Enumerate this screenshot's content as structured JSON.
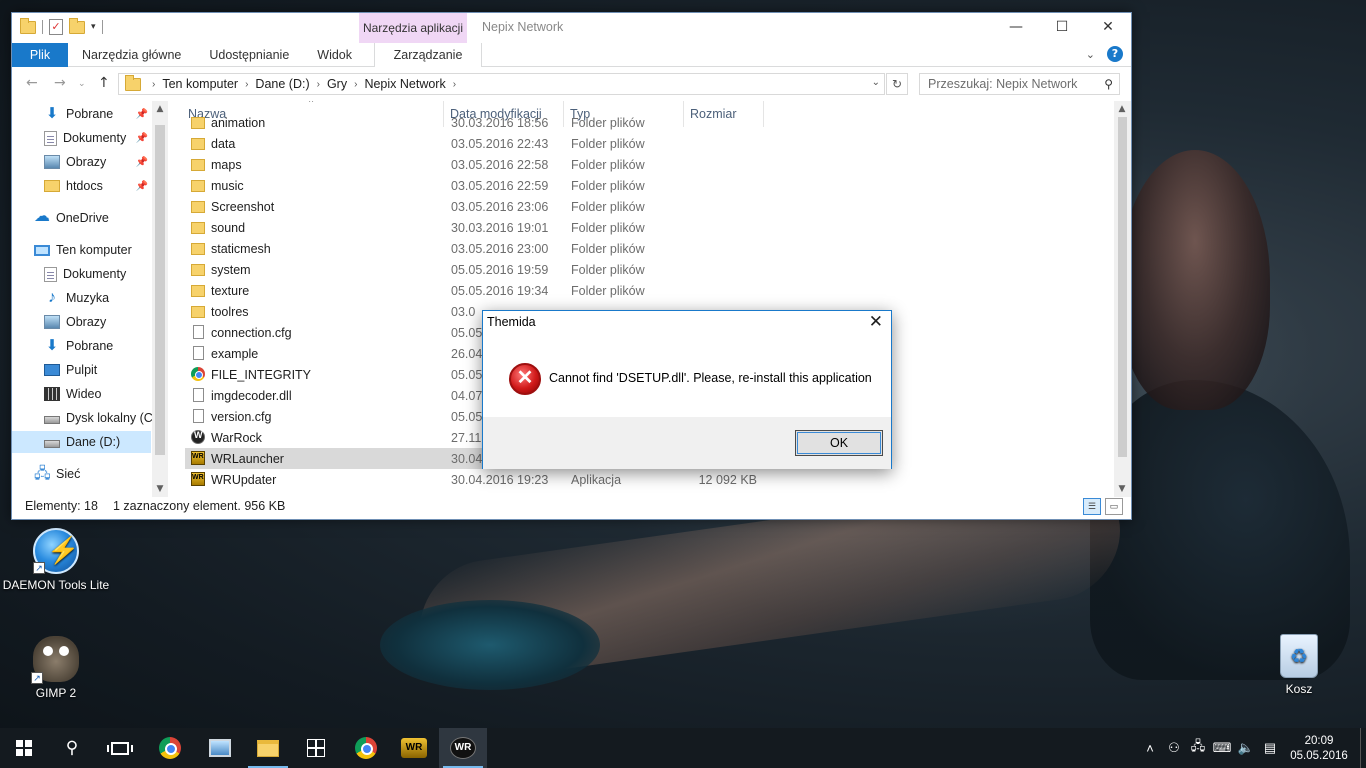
{
  "explorer": {
    "window_title": "Nepix Network",
    "contextual_tab_header": "Narzędzia aplikacji",
    "ribbon_tabs": [
      "Plik",
      "Narzędzia główne",
      "Udostępnianie",
      "Widok",
      "Zarządzanie"
    ],
    "breadcrumb": [
      "Ten komputer",
      "Dane (D:)",
      "Gry",
      "Nepix Network"
    ],
    "search_placeholder": "Przeszukaj: Nepix Network",
    "nav_items": [
      {
        "label": "Pobrane",
        "icon": "download-icon",
        "pinned": true
      },
      {
        "label": "Dokumenty",
        "icon": "documents-icon",
        "pinned": true
      },
      {
        "label": "Obrazy",
        "icon": "pictures-icon",
        "pinned": true
      },
      {
        "label": "htdocs",
        "icon": "folder-icon",
        "pinned": true
      },
      {
        "label": "OneDrive",
        "icon": "onedrive-icon"
      },
      {
        "label": "Ten komputer",
        "icon": "computer-icon"
      },
      {
        "label": "Dokumenty",
        "icon": "documents-icon"
      },
      {
        "label": "Muzyka",
        "icon": "music-icon"
      },
      {
        "label": "Obrazy",
        "icon": "pictures-icon"
      },
      {
        "label": "Pobrane",
        "icon": "download-icon"
      },
      {
        "label": "Pulpit",
        "icon": "desktop-icon"
      },
      {
        "label": "Wideo",
        "icon": "video-icon"
      },
      {
        "label": "Dysk lokalny (C:)",
        "icon": "drive-icon"
      },
      {
        "label": "Dane (D:)",
        "icon": "drive-icon",
        "selected": true
      },
      {
        "label": "Sieć",
        "icon": "network-icon"
      }
    ],
    "columns": {
      "name": "Nazwa",
      "date": "Data modyfikacji",
      "type": "Typ",
      "size": "Rozmiar"
    },
    "files": [
      {
        "name": "animation",
        "date": "30.03.2016 18:56",
        "type": "Folder plików",
        "size": "",
        "icon": "folder"
      },
      {
        "name": "data",
        "date": "03.05.2016 22:43",
        "type": "Folder plików",
        "size": "",
        "icon": "folder"
      },
      {
        "name": "maps",
        "date": "03.05.2016 22:58",
        "type": "Folder plików",
        "size": "",
        "icon": "folder"
      },
      {
        "name": "music",
        "date": "03.05.2016 22:59",
        "type": "Folder plików",
        "size": "",
        "icon": "folder"
      },
      {
        "name": "Screenshot",
        "date": "03.05.2016 23:06",
        "type": "Folder plików",
        "size": "",
        "icon": "folder"
      },
      {
        "name": "sound",
        "date": "30.03.2016 19:01",
        "type": "Folder plików",
        "size": "",
        "icon": "folder"
      },
      {
        "name": "staticmesh",
        "date": "03.05.2016 23:00",
        "type": "Folder plików",
        "size": "",
        "icon": "folder"
      },
      {
        "name": "system",
        "date": "05.05.2016 19:59",
        "type": "Folder plików",
        "size": "",
        "icon": "folder"
      },
      {
        "name": "texture",
        "date": "05.05.2016 19:34",
        "type": "Folder plików",
        "size": "",
        "icon": "folder"
      },
      {
        "name": "toolres",
        "date": "03.0",
        "type": "",
        "size": "",
        "icon": "folder"
      },
      {
        "name": "connection.cfg",
        "date": "05.05.",
        "type": "",
        "size": "",
        "icon": "file"
      },
      {
        "name": "example",
        "date": "26.04.",
        "type": "",
        "size": "",
        "icon": "file"
      },
      {
        "name": "FILE_INTEGRITY",
        "date": "05.05.",
        "type": "",
        "size": "",
        "icon": "chrome"
      },
      {
        "name": "imgdecoder.dll",
        "date": "04.07.",
        "type": "",
        "size": "",
        "icon": "file"
      },
      {
        "name": "version.cfg",
        "date": "05.05.",
        "type": "",
        "size": "",
        "icon": "file"
      },
      {
        "name": "WarRock",
        "date": "27.11.",
        "type": "",
        "size": "",
        "icon": "warrock"
      },
      {
        "name": "WRLauncher",
        "date": "30.04.",
        "type": "",
        "size": "",
        "icon": "wrlauncher",
        "selected": true
      },
      {
        "name": "WRUpdater",
        "date": "30.04.2016 19:23",
        "type": "Aplikacja",
        "size": "12 092 KB",
        "icon": "wrlauncher"
      }
    ],
    "status": {
      "count": "Elementy: 18",
      "selection": "1 zaznaczony element. 956 KB"
    }
  },
  "dialog": {
    "title": "Themida",
    "message": "Cannot find 'DSETUP.dll'. Please, re-install this application",
    "ok_label": "OK"
  },
  "desktop_icons": [
    {
      "label": "DAEMON Tools Lite"
    },
    {
      "label": "GIMP 2"
    },
    {
      "label": "Kosz"
    }
  ],
  "taskbar": {
    "time": "20:09",
    "date": "05.05.2016"
  }
}
